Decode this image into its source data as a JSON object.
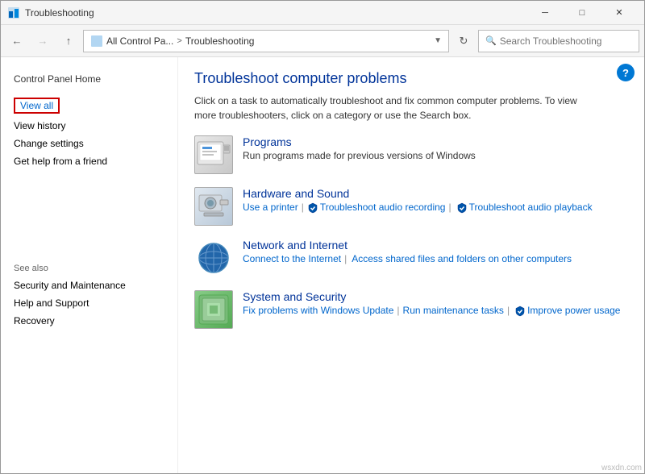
{
  "window": {
    "title": "Troubleshooting",
    "icon": "control-panel-icon"
  },
  "titlebar": {
    "minimize_label": "─",
    "maximize_label": "□",
    "close_label": "✕"
  },
  "addressbar": {
    "back_tooltip": "Back",
    "forward_tooltip": "Forward",
    "up_tooltip": "Up",
    "breadcrumb_part1": "All Control Pa...",
    "separator": ">",
    "breadcrumb_part2": "Troubleshooting",
    "search_placeholder": "Search Troubleshooting"
  },
  "sidebar": {
    "control_panel_home": "Control Panel Home",
    "view_all": "View all",
    "view_history": "View history",
    "change_settings": "Change settings",
    "get_help": "Get help from a friend",
    "see_also_title": "See also",
    "see_also_items": [
      "Security and Maintenance",
      "Help and Support",
      "Recovery"
    ]
  },
  "content": {
    "page_title": "Troubleshoot computer problems",
    "page_desc": "Click on a task to automatically troubleshoot and fix common computer problems. To view more troubleshooters, click on a category or use the Search box.",
    "categories": [
      {
        "id": "programs",
        "name": "Programs",
        "desc": "Run programs made for previous versions of Windows",
        "links": []
      },
      {
        "id": "hardware",
        "name": "Hardware and Sound",
        "links": [
          {
            "label": "Use a printer",
            "type": "plain"
          },
          {
            "label": "Troubleshoot audio recording",
            "type": "shield"
          },
          {
            "label": "Troubleshoot audio playback",
            "type": "shield"
          }
        ]
      },
      {
        "id": "network",
        "name": "Network and Internet",
        "links": [
          {
            "label": "Connect to the Internet",
            "type": "plain"
          },
          {
            "label": "Access shared files and folders on other computers",
            "type": "plain"
          }
        ]
      },
      {
        "id": "system",
        "name": "System and Security",
        "links": [
          {
            "label": "Fix problems with Windows Update",
            "type": "plain"
          },
          {
            "label": "Run maintenance tasks",
            "type": "plain"
          },
          {
            "label": "Improve power usage",
            "type": "shield"
          }
        ]
      }
    ]
  },
  "help_button": "?",
  "watermark": "wsxdn.com"
}
